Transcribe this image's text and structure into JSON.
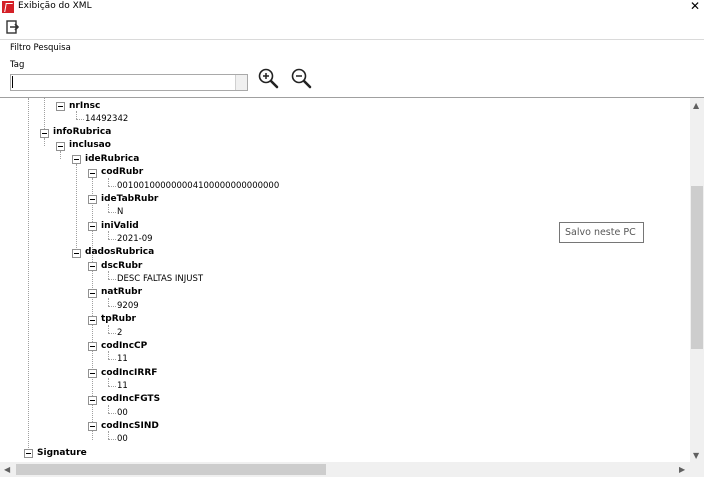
{
  "window": {
    "title": "Exibição do XML",
    "close_glyph": "✕"
  },
  "toolbar": {
    "exit_icon": "exit-icon"
  },
  "filter": {
    "section_label": "Filtro Pesquisa",
    "tag_label": "Tag",
    "tag_value": "",
    "zoom_in_icon": "zoom-in-icon",
    "zoom_out_icon": "zoom-out-icon"
  },
  "tree": {
    "nodes": {
      "nrInsc": "nrInsc",
      "infoRubrica": "infoRubrica",
      "inclusao": "inclusao",
      "ideRubrica": "ideRubrica",
      "codRubr": "codRubr",
      "ideTabRubr": "ideTabRubr",
      "iniValid": "iniValid",
      "dadosRubrica": "dadosRubrica",
      "dscRubr": "dscRubr",
      "natRubr": "natRubr",
      "tpRubr": "tpRubr",
      "codIncCP": "codIncCP",
      "codIncIRRF": "codIncIRRF",
      "codIncFGTS": "codIncFGTS",
      "codIncSIND": "codIncSIND",
      "Signature": "Signature"
    },
    "values": {
      "nrInsc": "14492342",
      "codRubr": "001001000000004100000000000000",
      "ideTabRubr": "N",
      "iniValid": "2021-09",
      "dscRubr": "DESC FALTAS INJUST",
      "natRubr": "9209",
      "tpRubr": "2",
      "codIncCP": "11",
      "codIncIRRF": "11",
      "codIncFGTS": "00",
      "codIncSIND": "00"
    }
  },
  "tooltip": {
    "text": "Salvo neste PC"
  }
}
